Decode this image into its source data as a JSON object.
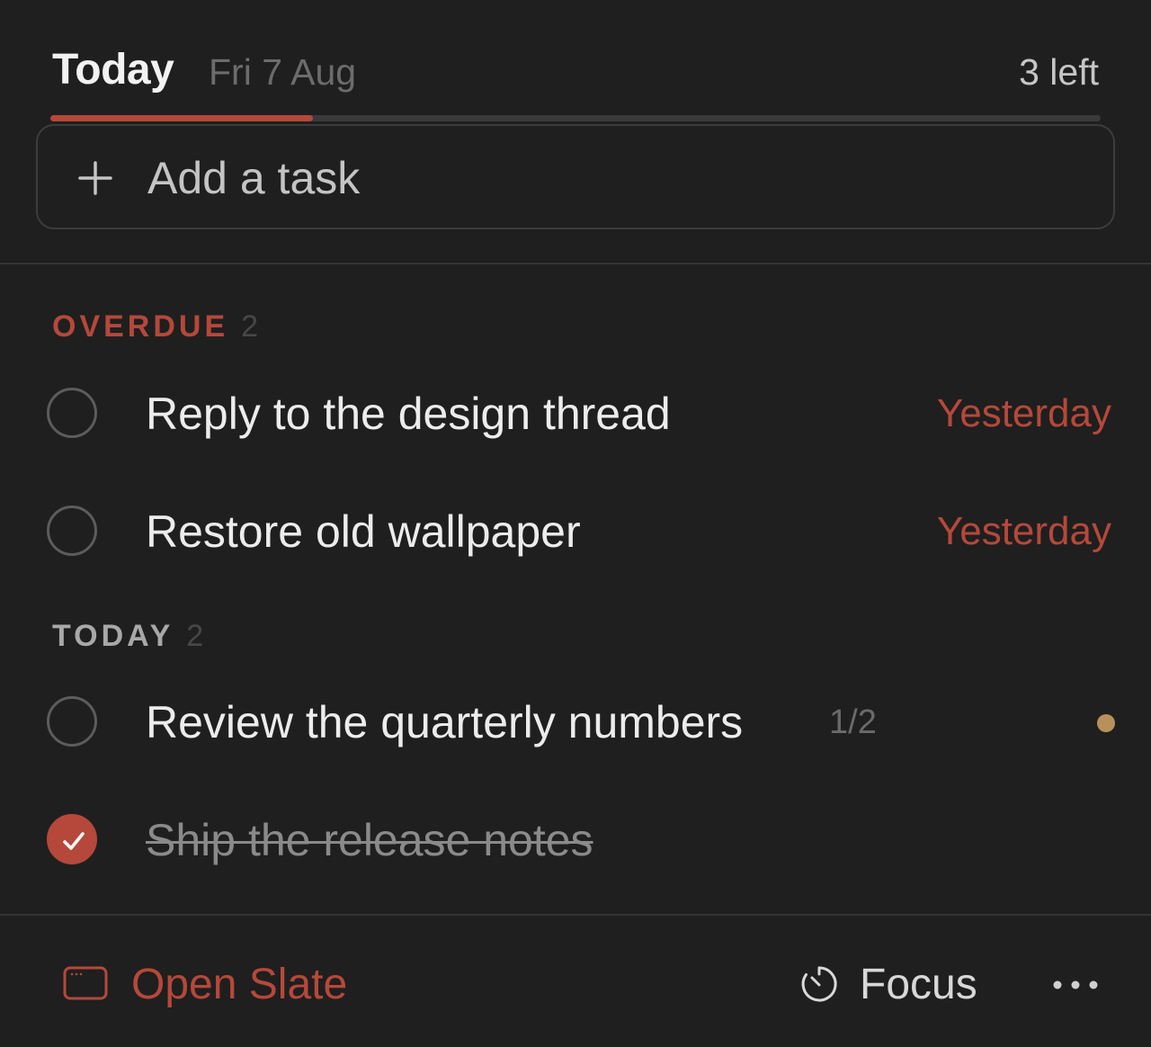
{
  "header": {
    "title": "Today",
    "date": "Fri 7 Aug",
    "remaining": "3 left",
    "progress_fraction": 0.25
  },
  "add_task": {
    "icon": "plus-icon",
    "label": "Add a task"
  },
  "sections": [
    {
      "title": "OVERDUE",
      "count": "2",
      "color": "#b5483a",
      "tasks": [
        {
          "text": "Reply to the design thread",
          "due": "Yesterday",
          "completed": false
        },
        {
          "text": "Restore old wallpaper",
          "due": "Yesterday",
          "completed": false
        }
      ]
    },
    {
      "title": "TODAY",
      "count": "2",
      "color": "#a8a8a8",
      "tasks": [
        {
          "text": "Review the quarterly numbers",
          "subtasks": "1/2",
          "dot_color": "#b8915a",
          "completed": false
        },
        {
          "text": "Ship the release notes",
          "completed": true
        }
      ]
    }
  ],
  "footer": {
    "open_slate": {
      "icon": "window-icon",
      "label": "Open Slate"
    },
    "focus": {
      "icon": "timer-icon",
      "label": "Focus"
    },
    "more": {
      "icon": "more-horizontal-icon"
    }
  },
  "colors": {
    "accent": "#b5483a",
    "background": "#1f1f1f"
  }
}
